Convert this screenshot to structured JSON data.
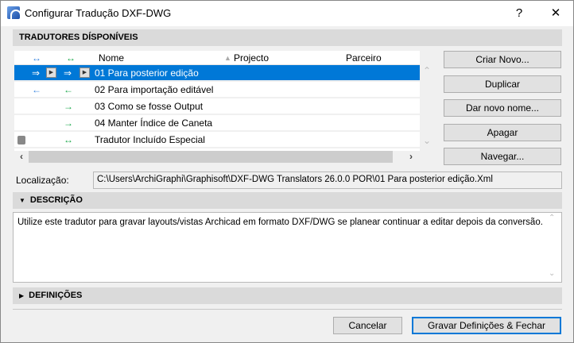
{
  "window": {
    "title": "Configurar Tradução DXF-DWG",
    "help": "?",
    "close": "✕"
  },
  "translators": {
    "header": "TRADUTORES DÍSPONÍVEIS",
    "columns": {
      "import_icon": "↔",
      "export_icon": "↔",
      "name": "Nome",
      "project": "Projecto",
      "partner": "Parceiro"
    },
    "rows": [
      {
        "a": "⇒",
        "b": "⇒",
        "name": "01 Para posterior edição",
        "selected": true
      },
      {
        "a": "←",
        "b": "←",
        "name": "02 Para importação editável"
      },
      {
        "a": "",
        "b": "→",
        "name": "03 Como se fosse Output"
      },
      {
        "a": "",
        "b": "→",
        "name": "04 Manter Índice de Caneta"
      },
      {
        "a": "lock",
        "b": "↔",
        "name": "Tradutor Incluído Especial"
      }
    ]
  },
  "buttons": {
    "new": "Criar Novo...",
    "duplicate": "Duplicar",
    "rename": "Dar novo nome...",
    "delete": "Apagar",
    "browse": "Navegar...",
    "cancel": "Cancelar",
    "save": "Gravar Definições & Fechar"
  },
  "location": {
    "label": "Localização:",
    "value": "C:\\Users\\ArchiGraphi\\Graphisoft\\DXF-DWG Translators 26.0.0 POR\\01 Para posterior edição.Xml"
  },
  "description": {
    "header": "DESCRIÇÃO",
    "text": "Utilize este tradutor para gravar layouts/vistas Archicad em formato DXF/DWG se planear continuar a editar depois da conversão."
  },
  "settings": {
    "header": "DEFINIÇÕES"
  }
}
